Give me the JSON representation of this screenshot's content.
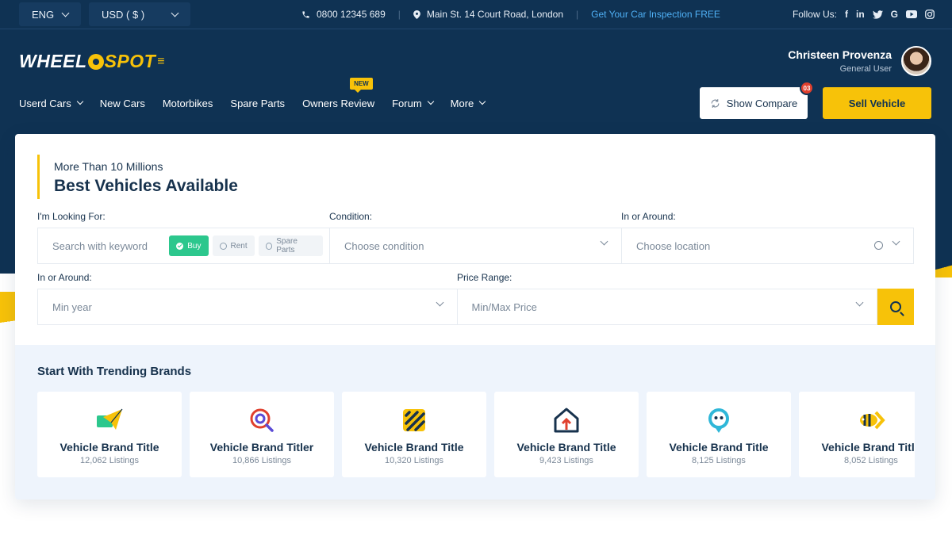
{
  "topbar": {
    "language": "ENG",
    "currency": "USD ( $ )",
    "phone": "0800 12345 689",
    "address": "Main St. 14 Court Road, London",
    "promo": "Get Your Car Inspection FREE",
    "follow_label": "Follow Us:",
    "social": [
      "f",
      "in",
      "t",
      "G",
      "yt",
      "ig"
    ]
  },
  "logo": {
    "part1": "WHEEL",
    "part2": "SPOT"
  },
  "user": {
    "name": "Christeen Provenza",
    "role": "General User"
  },
  "nav": {
    "items": [
      {
        "label": "Userd Cars",
        "dropdown": true
      },
      {
        "label": "New Cars",
        "dropdown": false
      },
      {
        "label": "Motorbikes",
        "dropdown": false
      },
      {
        "label": "Spare Parts",
        "dropdown": false
      },
      {
        "label": "Owners Review",
        "dropdown": false,
        "badge": "NEW"
      },
      {
        "label": "Forum",
        "dropdown": true
      },
      {
        "label": "More",
        "dropdown": true
      }
    ]
  },
  "actions": {
    "compare_label": "Show Compare",
    "compare_count": "03",
    "sell_label": "Sell Vehicle"
  },
  "search": {
    "heading_sub": "More Than 10 Millions",
    "heading_main": "Best Vehicles Available",
    "looking_label": "I'm Looking For:",
    "keyword_placeholder": "Search with keyword",
    "modes": [
      "Buy",
      "Rent",
      "Spare Parts"
    ],
    "condition_label": "Condition:",
    "condition_placeholder": "Choose condition",
    "location_label": "In or Around:",
    "location_placeholder": "Choose location",
    "year_label": "In or Around:",
    "year_placeholder": "Min year",
    "price_label": "Price Range:",
    "price_placeholder": "Min/Max Price"
  },
  "brands": {
    "title": "Start With Trending Brands",
    "items": [
      {
        "title": "Vehicle Brand Title",
        "count": "12,062 Listings",
        "icon": "paper-plane-icon"
      },
      {
        "title": "Vehicle Brand Titler",
        "count": "10,866 Listings",
        "icon": "magnifier-q-icon"
      },
      {
        "title": "Vehicle Brand Title",
        "count": "10,320 Listings",
        "icon": "striped-square-icon"
      },
      {
        "title": "Vehicle Brand Title",
        "count": "9,423 Listings",
        "icon": "house-arrow-icon"
      },
      {
        "title": "Vehicle Brand Title",
        "count": "8,125 Listings",
        "icon": "chat-bubble-icon"
      },
      {
        "title": "Vehicle Brand Title",
        "count": "8,052 Listings",
        "icon": "bee-arrow-icon"
      }
    ]
  },
  "colors": {
    "navy": "#0f3253",
    "yellow": "#f7c209",
    "green": "#2cc78d",
    "red": "#e0402e",
    "link": "#4fb0f5"
  }
}
